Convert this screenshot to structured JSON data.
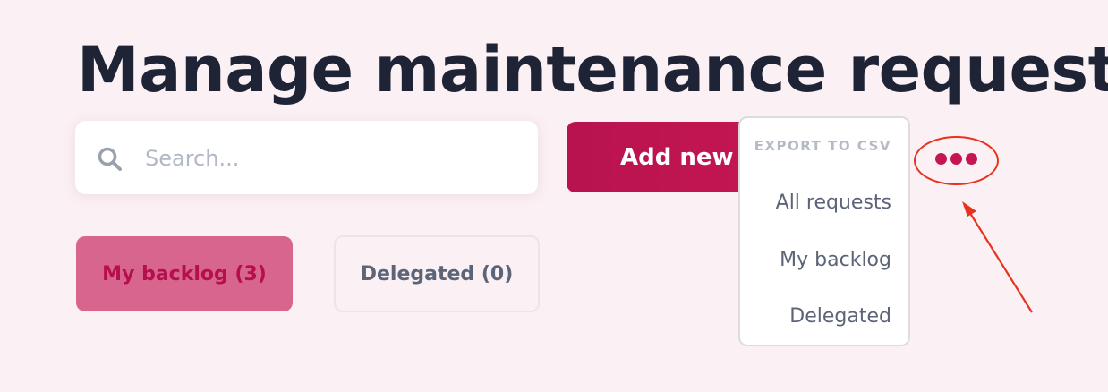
{
  "header": {
    "title": "Manage maintenance requests"
  },
  "search": {
    "placeholder": "Search...",
    "value": "",
    "icon": "search-icon"
  },
  "toolbar": {
    "add_label": "Add new",
    "more_icon": "more-horizontal-icon"
  },
  "tabs": [
    {
      "label": "My backlog (3)",
      "active": true
    },
    {
      "label": "Delegated (0)",
      "active": false
    }
  ],
  "export_menu": {
    "heading": "EXPORT TO CSV",
    "items": [
      {
        "label": "All requests"
      },
      {
        "label": "My backlog"
      },
      {
        "label": "Delegated"
      }
    ]
  },
  "colors": {
    "background": "#fbf0f3",
    "brand": "#c41652",
    "active_tab_bg": "#d8658e",
    "annotation": "#e8321e"
  }
}
